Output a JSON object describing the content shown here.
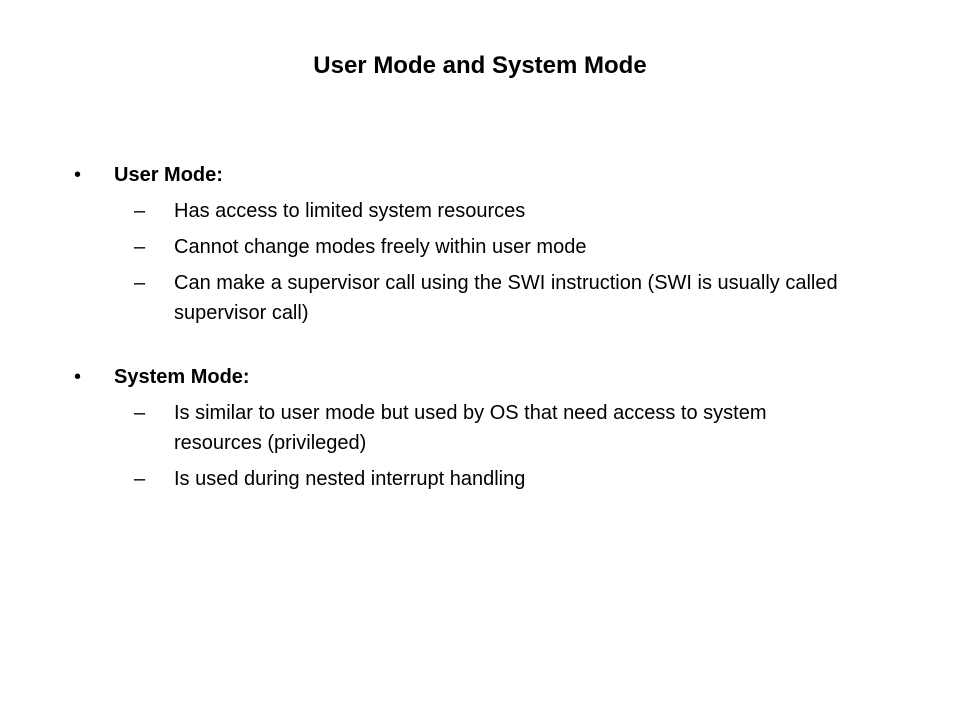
{
  "slide": {
    "title": "User Mode and System Mode",
    "sections": [
      {
        "heading": "User Mode:",
        "items": [
          "Has access to limited system resources",
          "Cannot change modes freely within user mode",
          "Can make a supervisor call using the SWI instruction (SWI is usually called supervisor call)"
        ]
      },
      {
        "heading": "System Mode:",
        "items": [
          "Is similar to user mode but used by OS that need access to system resources (privileged)",
          "Is used during nested interrupt handling"
        ]
      }
    ]
  },
  "markers": {
    "bullet": "•",
    "dash": "–"
  }
}
